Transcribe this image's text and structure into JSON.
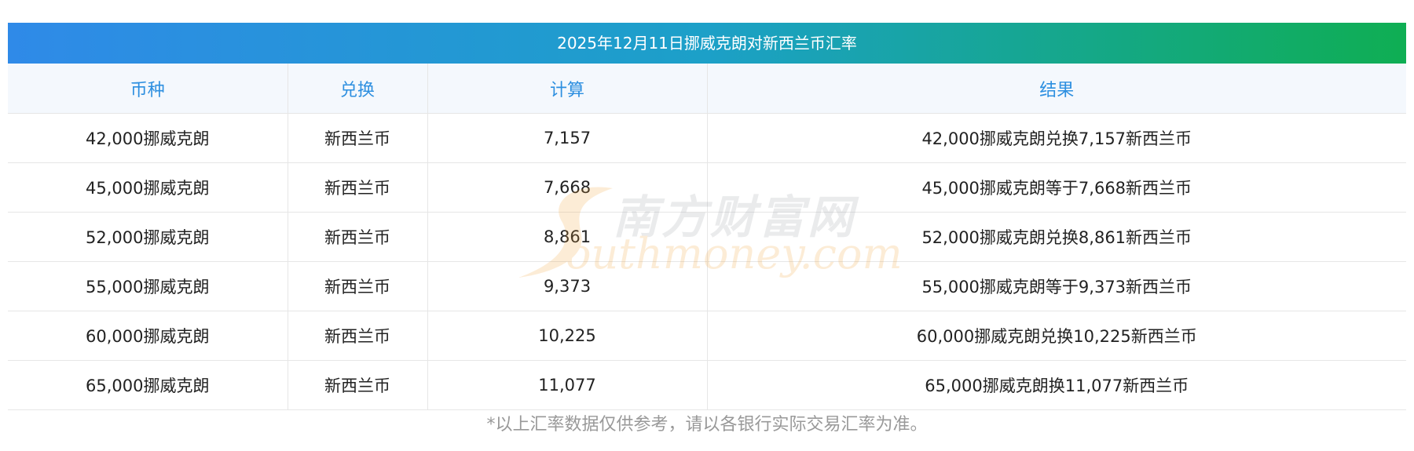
{
  "table": {
    "title": "2025年12月11日挪威克朗对新西兰币汇率",
    "headers": [
      "币种",
      "兑换",
      "计算",
      "结果"
    ],
    "rows": [
      {
        "currency": "42,000挪威克朗",
        "target": "新西兰币",
        "amount": "7,157",
        "result": "42,000挪威克朗兑换7,157新西兰币"
      },
      {
        "currency": "45,000挪威克朗",
        "target": "新西兰币",
        "amount": "7,668",
        "result": "45,000挪威克朗等于7,668新西兰币"
      },
      {
        "currency": "52,000挪威克朗",
        "target": "新西兰币",
        "amount": "8,861",
        "result": "52,000挪威克朗兑换8,861新西兰币"
      },
      {
        "currency": "55,000挪威克朗",
        "target": "新西兰币",
        "amount": "9,373",
        "result": "55,000挪威克朗等于9,373新西兰币"
      },
      {
        "currency": "60,000挪威克朗",
        "target": "新西兰币",
        "amount": "10,225",
        "result": "60,000挪威克朗兑换10,225新西兰币"
      },
      {
        "currency": "65,000挪威克朗",
        "target": "新西兰币",
        "amount": "11,077",
        "result": "65,000挪威克朗换11,077新西兰币"
      }
    ]
  },
  "watermark": {
    "cn": "南方财富网",
    "en": "outhmoney.com"
  },
  "footnote": "*以上汇率数据仅供参考，请以各银行实际交易汇率为准。",
  "colors": {
    "title_gradient_start": "#2f8ae8",
    "title_gradient_end": "#0fae53",
    "header_text": "#2d8fe0",
    "header_bg": "#f4f8fd"
  }
}
